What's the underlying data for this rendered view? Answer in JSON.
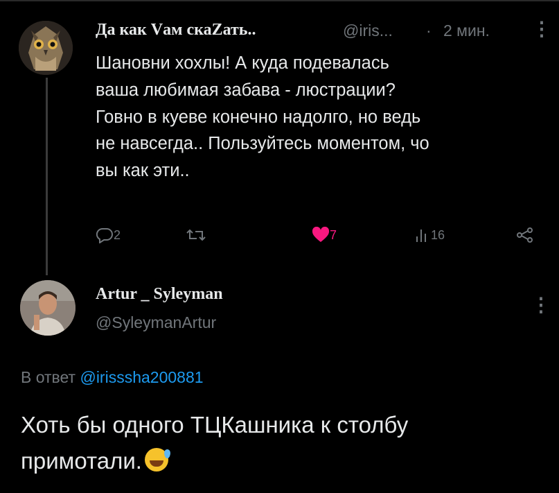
{
  "tweet1": {
    "display_name": "Да как Vам скаZать..",
    "handle": "@iris...",
    "separator": "·",
    "time": "2 мин.",
    "more_icon": "more-vertical-icon",
    "lines": [
      "Шановни хохлы! А куда подевалась",
      "ваша любимая забава - люстрации?",
      "Говно в куеве конечно надолго, но ведь",
      "не навсегда.. Пользуйтесь моментом, чо",
      "вы как эти.."
    ],
    "actions": {
      "reply_count": "2",
      "retweet_count": "",
      "like_count": "7",
      "views_count": "16"
    },
    "like_color": "#f91880"
  },
  "tweet2": {
    "display_name": "Artur _ Syleyman",
    "handle": "@SyleymanArtur",
    "replying_prefix": "В ответ",
    "replying_to": "@irisssha200881",
    "lines": [
      "Хоть бы одного ТЦКашника к столбу",
      "примотали."
    ],
    "emoji": "sweat-smile-emoji",
    "link_color": "#1d9bf0"
  }
}
